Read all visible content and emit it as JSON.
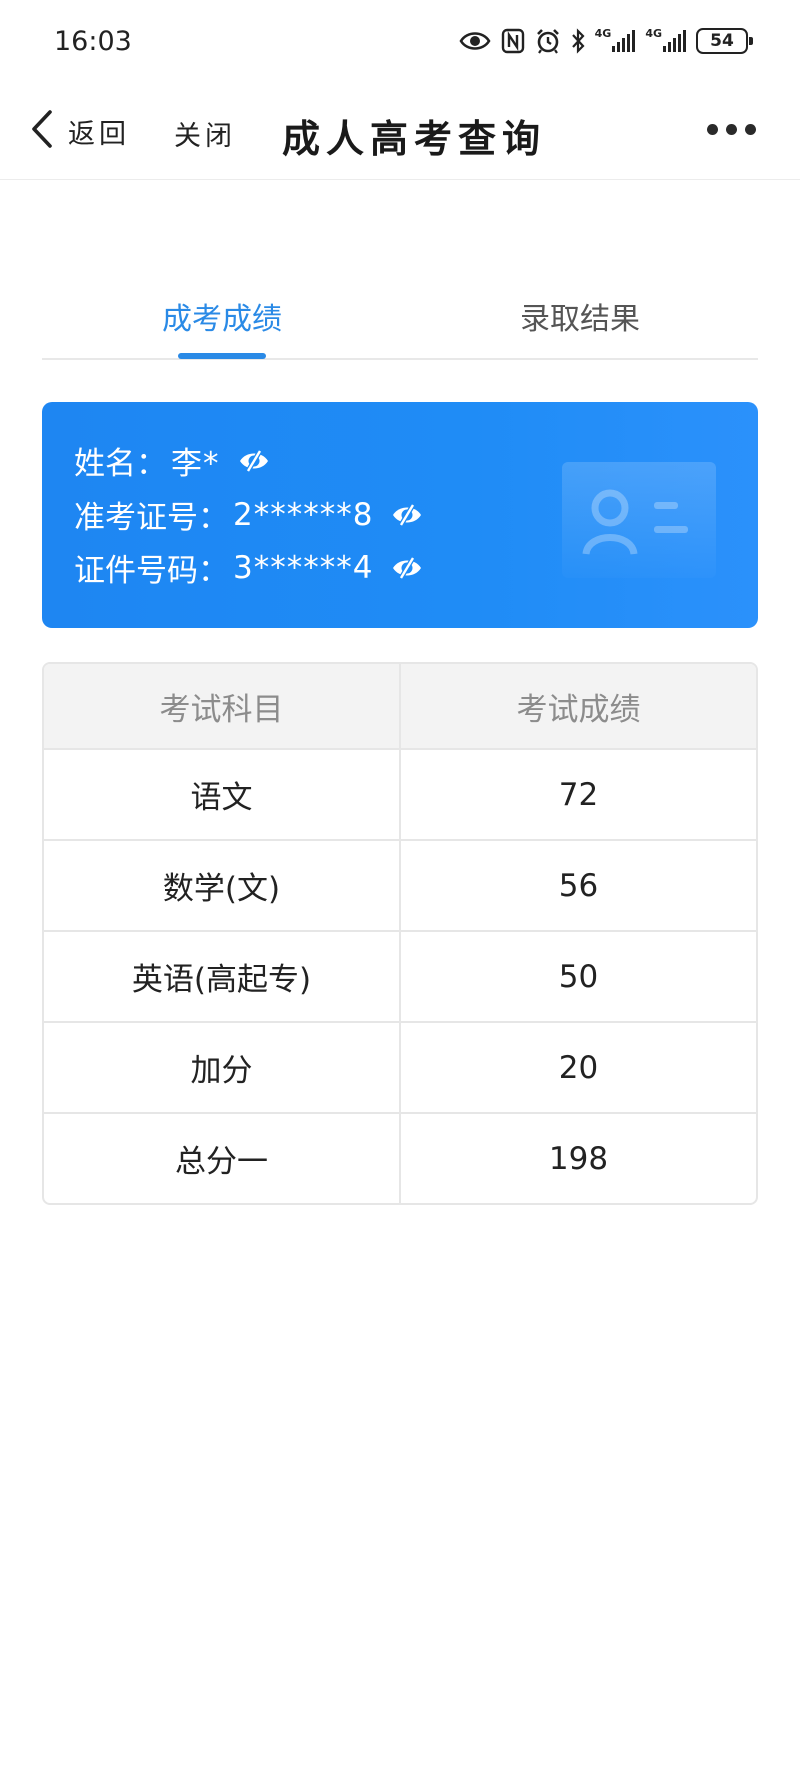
{
  "status_bar": {
    "time": "16:03",
    "network_1": "4G",
    "network_2": "4G",
    "battery": "54",
    "icons": [
      "eye-icon",
      "nfc-icon",
      "alarm-icon",
      "bluetooth-icon",
      "signal-icon",
      "signal-icon",
      "battery-icon"
    ]
  },
  "nav": {
    "back_label": "返回",
    "close_label": "关闭",
    "title": "成人高考查询"
  },
  "tabs": [
    {
      "label": "成考成绩",
      "active": true
    },
    {
      "label": "录取结果",
      "active": false
    }
  ],
  "info_card": {
    "name_label": "姓名：",
    "name_value": "李*",
    "ticket_label": "准考证号：",
    "ticket_value": "2******8",
    "id_label": "证件号码：",
    "id_value": "3******4"
  },
  "table": {
    "headers": [
      "考试科目",
      "考试成绩"
    ],
    "rows": [
      {
        "subject": "语文",
        "score": "72"
      },
      {
        "subject": "数学(文)",
        "score": "56"
      },
      {
        "subject": "英语(高起专)",
        "score": "50"
      },
      {
        "subject": "加分",
        "score": "20"
      },
      {
        "subject": "总分一",
        "score": "198"
      }
    ]
  },
  "colors": {
    "accent": "#2a8ae6",
    "card_bg": "#1f8cf6",
    "table_header_bg": "#f3f3f3",
    "border": "#e6e6e6"
  }
}
